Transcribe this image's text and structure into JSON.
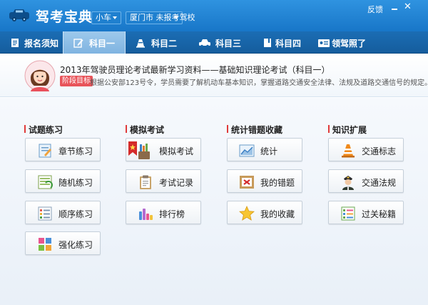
{
  "app": {
    "title": "驾考宝典"
  },
  "filters": {
    "car_type": "小车",
    "city_school": "厦门市 未报考驾校"
  },
  "window": {
    "feedback": "反馈",
    "close": "✕"
  },
  "tabs": [
    {
      "label": "报名须知",
      "icon": "signup-doc-icon"
    },
    {
      "label": "科目一",
      "icon": "edit-icon",
      "active": true
    },
    {
      "label": "科目二",
      "icon": "traffic-cone-icon"
    },
    {
      "label": "科目三",
      "icon": "car-icon"
    },
    {
      "label": "科目四",
      "icon": "book-icon"
    },
    {
      "label": "领驾照了",
      "icon": "license-card-icon"
    }
  ],
  "banner": {
    "title": "2013年驾驶员理论考试最新学习资料——基础知识理论考试（科目一）",
    "stage_badge": "阶段目标",
    "description": "根据公安部123号令，学员需要了解机动车基本知识，掌握道路交通安全法律、法规及道路交通信号的规定。"
  },
  "sections": [
    {
      "title": "试题练习",
      "buttons": [
        "章节练习",
        "随机练习",
        "顺序练习",
        "强化练习"
      ]
    },
    {
      "title": "模拟考试",
      "buttons": [
        "模拟考试",
        "考试记录",
        "排行榜"
      ]
    },
    {
      "title": "统计错题收藏",
      "buttons": [
        "统计",
        "我的错题",
        "我的收藏"
      ]
    },
    {
      "title": "知识扩展",
      "buttons": [
        "交通标志",
        "交通法规",
        "过关秘籍"
      ]
    }
  ],
  "colors": {
    "titlebar": "#1f85d6",
    "tabbar": "#1766aa",
    "accent_red": "#e03a3a",
    "stage_badge": "#e8545a"
  }
}
